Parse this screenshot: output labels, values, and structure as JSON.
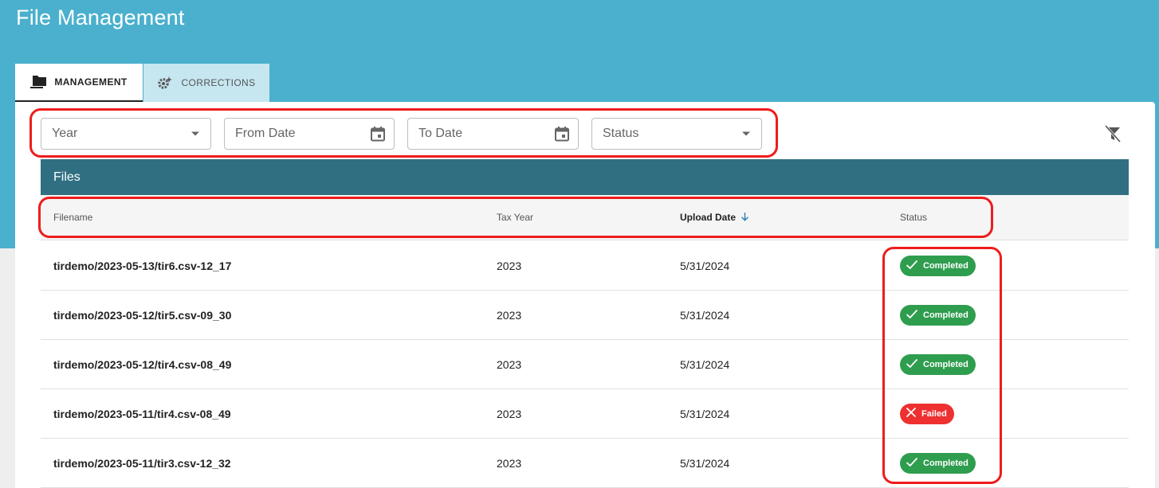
{
  "page": {
    "title": "File Management"
  },
  "tabs": [
    {
      "label": "MANAGEMENT",
      "icon": "folder-icon",
      "active": true
    },
    {
      "label": "CORRECTIONS",
      "icon": "gear-sparkle-icon",
      "active": false
    }
  ],
  "filters": {
    "year": {
      "placeholder": "Year",
      "icon": "dropdown-caret-icon"
    },
    "from_date": {
      "placeholder": "From Date",
      "icon": "calendar-icon"
    },
    "to_date": {
      "placeholder": "To Date",
      "icon": "calendar-icon"
    },
    "status": {
      "placeholder": "Status",
      "icon": "dropdown-caret-icon"
    },
    "clear_icon": "filter-off-icon"
  },
  "table": {
    "title": "Files",
    "columns": {
      "filename": "Filename",
      "tax_year": "Tax Year",
      "upload_date": "Upload Date",
      "status": "Status"
    },
    "sort": {
      "column": "upload_date",
      "direction": "descending",
      "icon": "arrow-down-icon"
    },
    "rows": [
      {
        "filename": "tirdemo/2023-05-13/tir6.csv-12_17",
        "tax_year": "2023",
        "upload_date": "5/31/2024",
        "status": "Completed"
      },
      {
        "filename": "tirdemo/2023-05-12/tir5.csv-09_30",
        "tax_year": "2023",
        "upload_date": "5/31/2024",
        "status": "Completed"
      },
      {
        "filename": "tirdemo/2023-05-12/tir4.csv-08_49",
        "tax_year": "2023",
        "upload_date": "5/31/2024",
        "status": "Completed"
      },
      {
        "filename": "tirdemo/2023-05-11/tir4.csv-08_49",
        "tax_year": "2023",
        "upload_date": "5/31/2024",
        "status": "Failed"
      },
      {
        "filename": "tirdemo/2023-05-11/tir3.csv-12_32",
        "tax_year": "2023",
        "upload_date": "5/31/2024",
        "status": "Completed"
      }
    ]
  },
  "colors": {
    "header_band": "#4ab0cd",
    "table_title_bar": "#306f82",
    "status_completed": "#2e9d4e",
    "status_failed": "#ee3030",
    "annotation_highlight": "#ee1c1c"
  }
}
